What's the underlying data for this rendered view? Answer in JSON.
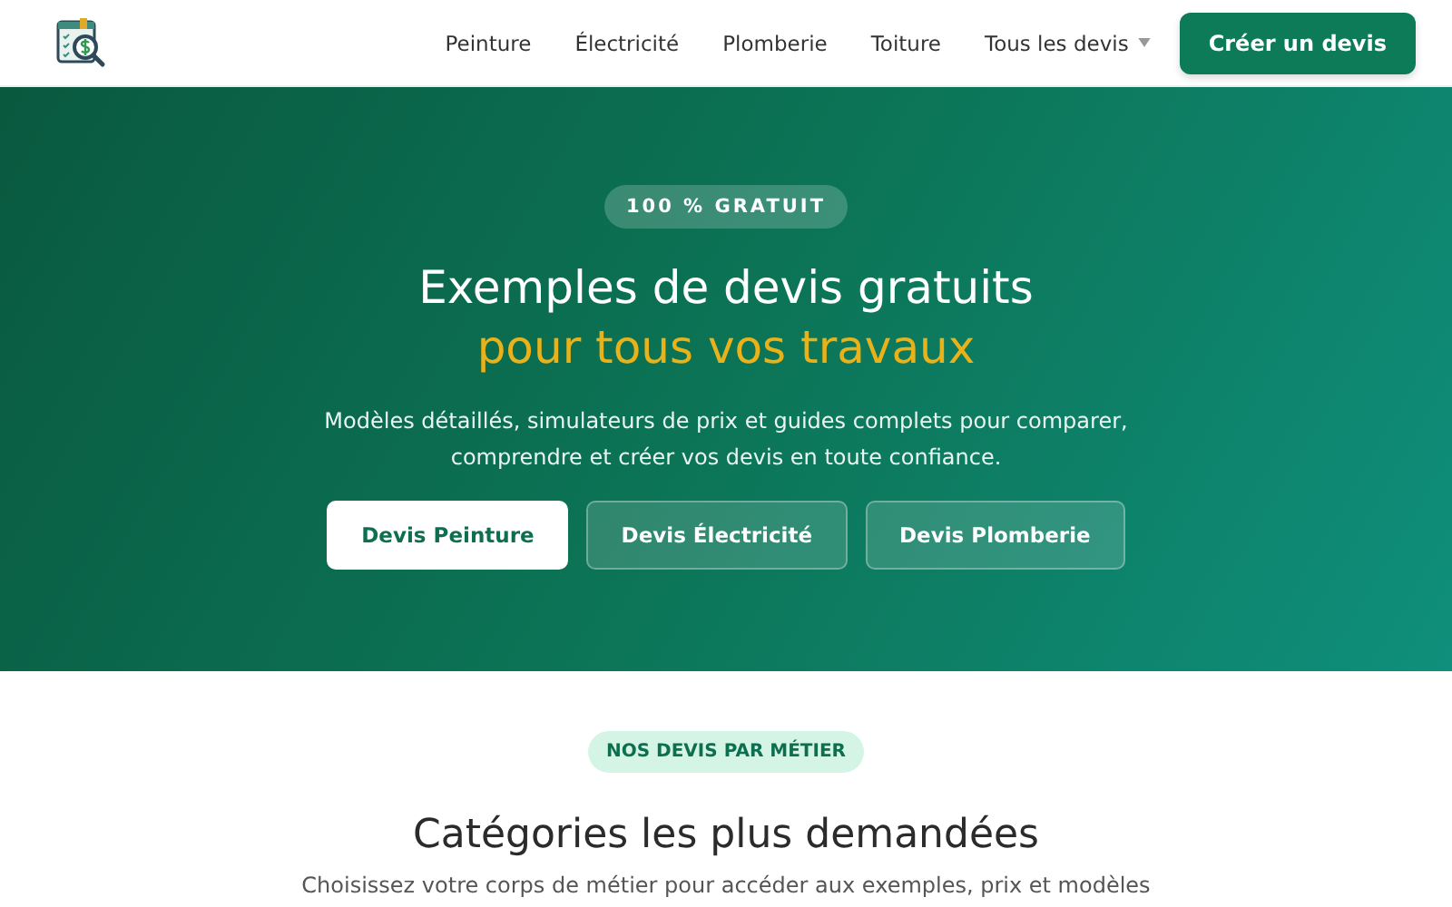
{
  "header": {
    "nav": [
      {
        "label": "Peinture",
        "kind": "link"
      },
      {
        "label": "Électricité",
        "kind": "link"
      },
      {
        "label": "Plomberie",
        "kind": "link"
      },
      {
        "label": "Toiture",
        "kind": "link"
      },
      {
        "label": "Tous les devis",
        "kind": "dropdown"
      }
    ],
    "cta": "Créer un devis"
  },
  "hero": {
    "badge": "100 % GRATUIT",
    "title": "Exemples de devis gratuits",
    "title_highlight": "pour tous vos travaux",
    "text": "Modèles détaillés, simulateurs de prix et guides complets pour comparer, comprendre et créer vos devis en toute confiance.",
    "buttons": [
      {
        "label": "Devis Peinture",
        "kind": "solid"
      },
      {
        "label": "Devis Électricité",
        "kind": "ghost"
      },
      {
        "label": "Devis Plomberie",
        "kind": "ghost"
      }
    ]
  },
  "section": {
    "badge": "NOS DEVIS PAR MÉTIER",
    "title": "Catégories les plus demandées",
    "text": "Choisissez votre corps de métier pour accéder aux exemples, prix et modèles"
  }
}
